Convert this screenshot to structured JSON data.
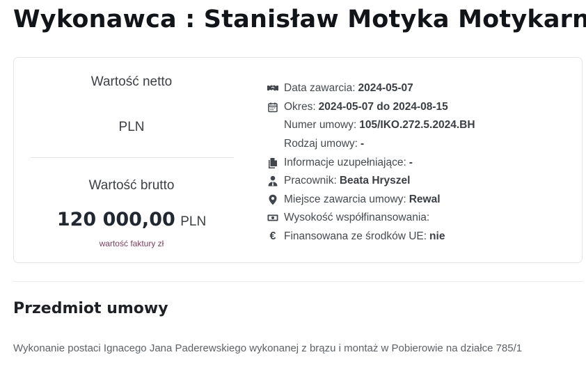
{
  "header": {
    "title": "Wykonawca : Stanisław Motyka Motykarnia"
  },
  "values": {
    "netto_label": "Wartość netto",
    "netto_currency": "PLN",
    "brutto_label": "Wartość brutto",
    "brutto_amount": "120 000,00",
    "brutto_currency": "PLN",
    "note": "wartość faktury zł"
  },
  "details": [
    {
      "icon": "handshake-icon",
      "label": "Data zawarcia:",
      "value": "2024-05-07"
    },
    {
      "icon": "calendar-icon",
      "label": "Okres:",
      "value": "2024-05-07 do 2024-08-15"
    },
    {
      "icon": "",
      "label": "Numer umowy:",
      "value": "105/IKO.272.5.2024.BH"
    },
    {
      "icon": "",
      "label": "Rodzaj umowy:",
      "value": "-"
    },
    {
      "icon": "documents-icon",
      "label": "Informacje uzupełniające:",
      "value": "-"
    },
    {
      "icon": "user-tie-icon",
      "label": "Pracownik:",
      "value": "Beata Hryszel"
    },
    {
      "icon": "map-marker-icon",
      "label": "Miejsce zawarcia umowy:",
      "value": "Rewal"
    },
    {
      "icon": "money-bill-icon",
      "label": "Wysokość współfinansowania:",
      "value": ""
    },
    {
      "icon": "euro-icon",
      "label": "Finansowana ze środków UE:",
      "value": "nie"
    }
  ],
  "section": {
    "title": "Przedmiot umowy",
    "description": "Wykonanie postaci Ignacego Jana Paderewskiego wykonanej z brązu i montaż w Pobierowie na działce 785/1"
  }
}
